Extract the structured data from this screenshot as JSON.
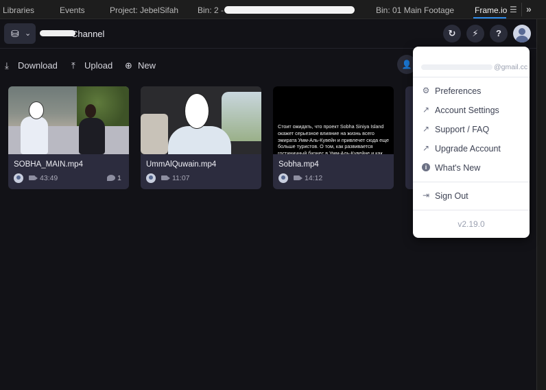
{
  "tabs": [
    {
      "label": "Libraries"
    },
    {
      "label": "Events"
    },
    {
      "label": "Project: JebelSifah"
    },
    {
      "label": "Bin: 2 - T"
    },
    {
      "label": "Bin: 01 Main Footage"
    },
    {
      "label": "Frame.io"
    }
  ],
  "header": {
    "project_name": "Channel"
  },
  "toolbar": {
    "download": "Download",
    "upload": "Upload",
    "new": "New"
  },
  "assets": [
    {
      "name": "SOBHA_MAIN.mp4",
      "duration": "43:49",
      "comments": "1"
    },
    {
      "name": "UmmAlQuwain.mp4",
      "duration": "11:07"
    },
    {
      "name": "Sobha.mp4",
      "duration": "14:12",
      "thumb_text": "Стоит ожидать, что проект Sobha Siniya Island окажет серьезное влияние на жизнь всего эмирата Умм-Аль-Кувейн и привлечет сюда еще больше туристов. О том, как развивается гостиничный бизнес в Умм-Аль-Кувейне и как"
    }
  ],
  "menu": {
    "email_suffix": "@gmail.cc",
    "items": {
      "preferences": "Preferences",
      "account_settings": "Account Settings",
      "support": "Support / FAQ",
      "upgrade": "Upgrade Account",
      "whats_new": "What's New",
      "sign_out": "Sign Out"
    },
    "version": "v2.19.0"
  },
  "colors": {
    "panel_bg": "#121217",
    "card_bg": "#2c2c3e",
    "tab_accent": "#2d8ceb",
    "menu_bg": "#ffffff"
  }
}
